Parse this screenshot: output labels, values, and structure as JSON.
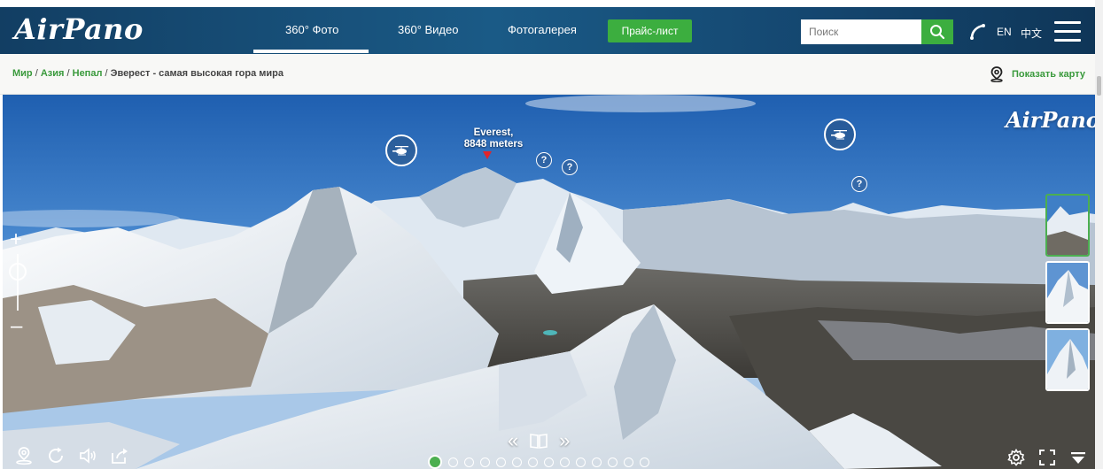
{
  "header": {
    "logo": "AirPano",
    "nav": [
      {
        "label": "360° Фото"
      },
      {
        "label": "360° Видео"
      },
      {
        "label": "Фотогалерея"
      }
    ],
    "price_button": "Прайс-лист",
    "search": {
      "placeholder": "Поиск"
    },
    "languages": [
      "EN",
      "中文"
    ]
  },
  "breadcrumb": {
    "links": [
      "Мир",
      "Азия",
      "Непал"
    ],
    "separator": "/",
    "current": "Эверест - самая высокая гора мира",
    "map_button": "Показать карту"
  },
  "pano": {
    "watermark": "AirPano",
    "peak_label_line1": "Everest,",
    "peak_label_line2": "8848 meters",
    "thumbnail_count": 3,
    "dot_count": 14,
    "active_dot": 1
  },
  "colors": {
    "header_bg": "#14466f",
    "accent_green": "#3cae3f",
    "link_green": "#3a9a3c",
    "marker_red": "#e0252b"
  }
}
